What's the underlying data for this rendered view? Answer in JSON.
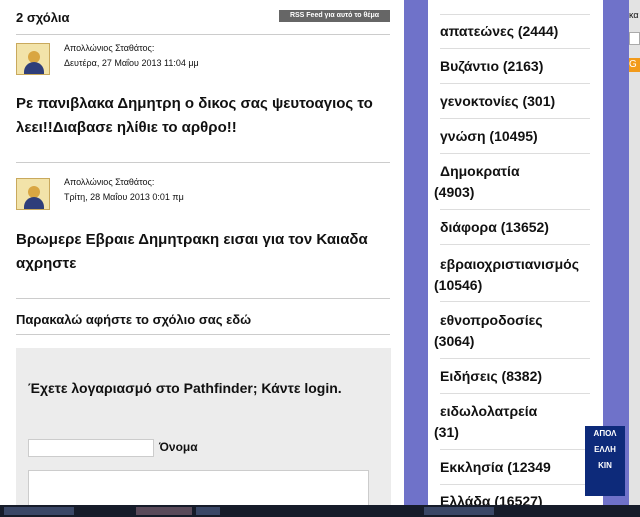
{
  "comments_section": {
    "title": "2 σχόλια",
    "rss_label": "RSS Feed για αυτό το θέμα",
    "comments": [
      {
        "author": "Απολλώνιος Σταθάτος:",
        "date": "Δευτέρα, 27 Μαΐου 2013 11:04 μμ",
        "text": "Ρε πανιβλακα Δημητρη ο δικος σας ψευτοαγιος το λεει!!Διαβασε ηλίθιε το αρθρο!!"
      },
      {
        "author": "Απολλώνιος Σταθάτος:",
        "date": "Τρίτη, 28 Μαΐου 2013 0:01 πμ",
        "text": "Βρωμερε Εβραιε Δημητρακη εισαι για τον Καιαδα αχρηστε"
      }
    ],
    "leave_comment_prompt": "Παρακαλώ αφήστε το σχόλιο σας εδώ",
    "form": {
      "login_prompt": "Έχετε λογαριασμό στο Pathfinder; Κάντε login.",
      "name_label": "Όνομα",
      "name_value": "",
      "comment_value": ""
    }
  },
  "sidebar": {
    "categories": [
      {
        "label": "απατεώνες (2444)"
      },
      {
        "label": "Βυζάντιο (2163)"
      },
      {
        "label": "γενοκτονίες (301)"
      },
      {
        "label": "γνώση (10495)"
      },
      {
        "line1": "Δημοκρατία",
        "line2": "(4903)"
      },
      {
        "label": "διάφορα (13652)"
      },
      {
        "line1": "εβραιοχριστιανισμός",
        "line2": "(10546)"
      },
      {
        "line1": "εθνοπροδοσίες",
        "line2": "(3064)"
      },
      {
        "label": "Ειδήσεις (8382)"
      },
      {
        "line1": "ειδωλολατρεία",
        "line2": "(31)"
      },
      {
        "label": "Εκκλησία (12349"
      },
      {
        "label": "Ελλάδα (16527)"
      }
    ]
  },
  "ad_banner": {
    "line1": "ΑΠΟΛ",
    "line2": "ΕΛΛΗ",
    "line3": "ΚΙΝ"
  },
  "right_ribbon": {
    "text": "κα",
    "icon_letter": "G"
  },
  "colors": {
    "page_background": "#6f72c9",
    "ad_background": "#0d2a7a"
  }
}
